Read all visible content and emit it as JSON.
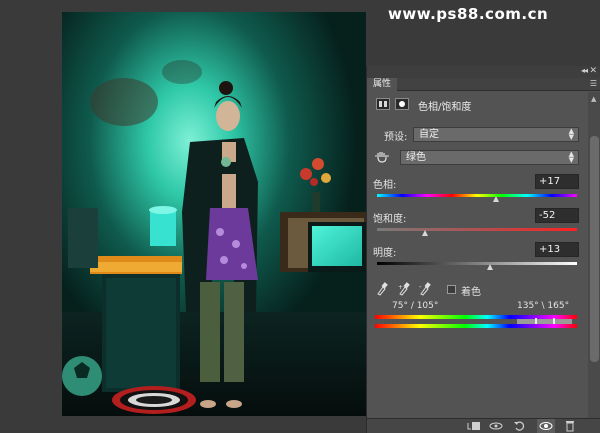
{
  "watermark": "www.ps88.com.cn",
  "panel": {
    "tab_label": "属性",
    "adjustment_title": "色相/饱和度",
    "preset": {
      "label": "预设:",
      "value": "自定"
    },
    "channel": {
      "value": "绿色"
    },
    "hue": {
      "label": "色相:",
      "value": "+17",
      "level": 0.594
    },
    "saturation": {
      "label": "饱和度:",
      "value": "-52",
      "level": 0.24
    },
    "lightness": {
      "label": "明度:",
      "value": "+13",
      "level": 0.565
    },
    "colorize_label": "着色",
    "range_left": "75° / 105°",
    "range_right": "135° \\ 165°"
  },
  "colors": {
    "panel_bg": "#535353",
    "canvas_bg": "#3a3a3a",
    "photo_teal": "#2fd6b5"
  },
  "icons": [
    "collapse-icon",
    "close-icon",
    "panel-menu-icon",
    "adjustment-layer-icon",
    "mask-icon",
    "targeted-adjust-hand-icon",
    "eyedropper-icon",
    "eyedropper-plus-icon",
    "eyedropper-minus-icon",
    "clip-to-layer-icon",
    "view-previous-icon",
    "reset-icon",
    "visibility-eye-icon",
    "trash-icon"
  ]
}
